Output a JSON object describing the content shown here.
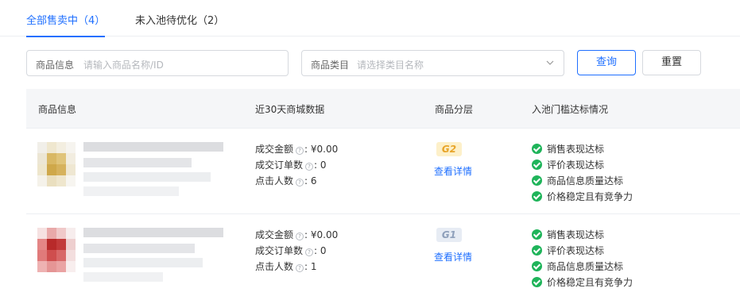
{
  "tabs": [
    {
      "label": "全部售卖中（4）",
      "active": true
    },
    {
      "label": "未入池待优化（2）",
      "active": false
    }
  ],
  "filters": {
    "product_info_label": "商品信息",
    "product_info_placeholder": "请输入商品名称/ID",
    "category_label": "商品类目",
    "category_placeholder": "请选择类目名称",
    "search_button": "查询",
    "reset_button": "重置"
  },
  "table": {
    "headers": [
      "商品信息",
      "近30天商城数据",
      "商品分层",
      "入池门槛达标情况"
    ],
    "rows": [
      {
        "metrics": [
          {
            "label": "成交金额",
            "value": "¥0.00"
          },
          {
            "label": "成交订单数",
            "value": "0"
          },
          {
            "label": "点击人数",
            "value": "6"
          }
        ],
        "tier": "G2",
        "detail_link": "查看详情",
        "criteria": [
          "销售表现达标",
          "评价表现达标",
          "商品信息质量达标",
          "价格稳定且有竞争力"
        ]
      },
      {
        "metrics": [
          {
            "label": "成交金额",
            "value": "¥0.00"
          },
          {
            "label": "成交订单数",
            "value": "0"
          },
          {
            "label": "点击人数",
            "value": "1"
          }
        ],
        "tier": "G1",
        "detail_link": "查看详情",
        "criteria": [
          "销售表现达标",
          "评价表现达标",
          "商品信息质量达标",
          "价格稳定且有竞争力"
        ]
      }
    ]
  },
  "colors": {
    "accent": "#1f6fff",
    "success": "#1fb45a",
    "tier_g2": "#e8a52a",
    "tier_g1": "#8fa0bb"
  }
}
